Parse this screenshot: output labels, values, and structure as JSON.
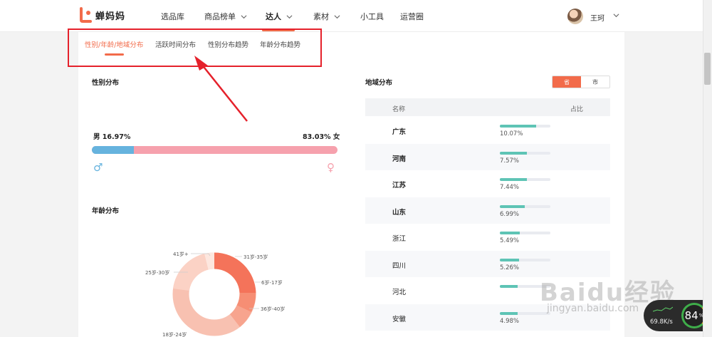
{
  "app": {
    "name": "蝉妈妈",
    "brand_color": "#f26b4a"
  },
  "nav": {
    "items": [
      {
        "label": "选品库",
        "has_dropdown": false
      },
      {
        "label": "商品榜单",
        "has_dropdown": true
      },
      {
        "label": "达人",
        "has_dropdown": true,
        "active": true
      },
      {
        "label": "素材",
        "has_dropdown": true
      },
      {
        "label": "小工具",
        "has_dropdown": false
      },
      {
        "label": "运营圈",
        "has_dropdown": false
      }
    ]
  },
  "user": {
    "name": "王珂"
  },
  "subtabs": [
    {
      "label": "性别/年龄/地域分布",
      "active": true
    },
    {
      "label": "活跃时间分布"
    },
    {
      "label": "性别分布趋势"
    },
    {
      "label": "年龄分布趋势"
    }
  ],
  "gender": {
    "title": "性别分布",
    "male_label": "男 16.97%",
    "female_label": "83.03% 女",
    "male_share": 0.1697,
    "male_symbol": "♂",
    "female_symbol": "♀",
    "male_color": "#66b3de",
    "female_color": "#f6a1ad"
  },
  "age": {
    "title": "年龄分布",
    "labels": [
      "41岁+",
      "31岁-35岁",
      "25岁-30岁",
      "6岁-17岁",
      "36岁-40岁",
      "18岁-24岁"
    ]
  },
  "region": {
    "title": "地域分布",
    "toggle": {
      "province": "省",
      "city": "市",
      "selected": "province"
    },
    "columns": {
      "name": "名称",
      "share": "占比"
    },
    "rows": [
      {
        "name": "广东",
        "pct": "10.07%",
        "value": 0.1007,
        "bold": true
      },
      {
        "name": "河南",
        "pct": "7.57%",
        "value": 0.0757,
        "bold": true
      },
      {
        "name": "江苏",
        "pct": "7.44%",
        "value": 0.0744,
        "bold": true
      },
      {
        "name": "山东",
        "pct": "6.99%",
        "value": 0.0699,
        "bold": true
      },
      {
        "name": "浙江",
        "pct": "5.49%",
        "value": 0.0549,
        "bold": false
      },
      {
        "name": "四川",
        "pct": "5.26%",
        "value": 0.0526,
        "bold": false
      },
      {
        "name": "河北",
        "pct": "",
        "value": 0.05,
        "bold": false
      },
      {
        "name": "安徽",
        "pct": "4.98%",
        "value": 0.0498,
        "bold": false
      }
    ]
  },
  "watermark": {
    "main": "Baidu经验",
    "sub": "jingyan.baidu.com"
  },
  "net_widget": {
    "speed": "69.8K/s",
    "percent": "84",
    "percent_unit": "%"
  }
}
